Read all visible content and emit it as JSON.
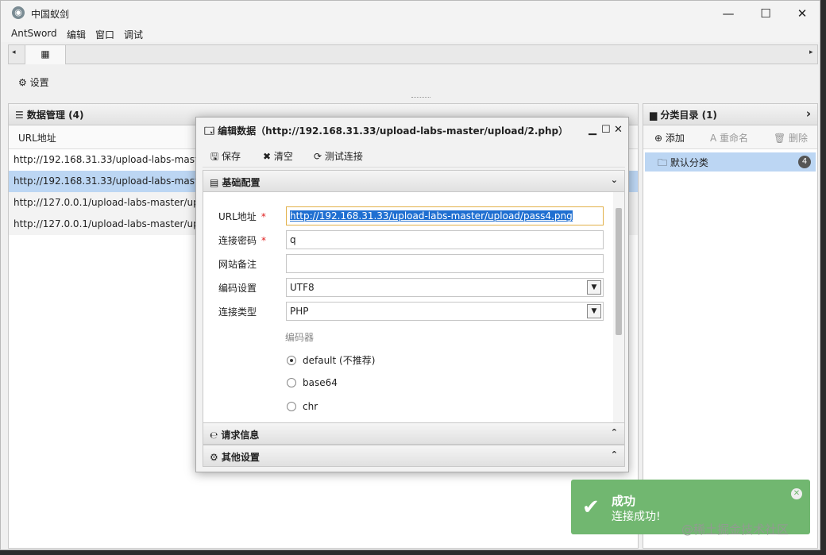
{
  "app": {
    "title": "中国蚁剑"
  },
  "window_controls": {
    "minimize": "—",
    "maximize": "☐",
    "close": "✕"
  },
  "menu": [
    "AntSword",
    "编辑",
    "窗口",
    "调试"
  ],
  "tabbar": {
    "left_arrow": "◂",
    "right_arrow": "▸",
    "home_tab_icon": "▦"
  },
  "toolbar": {
    "settings": "⚙ 设置"
  },
  "data_panel": {
    "title": "☰ 数据管理 (4)",
    "column_header": "URL地址",
    "rows": [
      "http://192.168.31.33/upload-labs-master",
      "http://192.168.31.33/upload-labs-master",
      "http://127.0.0.1/upload-labs-master/upl",
      "http://127.0.0.1/upload-labs-master/upl"
    ]
  },
  "category_panel": {
    "title": "▆ 分类目录 (1)",
    "chevron": "›",
    "add": "⊕ 添加",
    "rename": "A 重命名",
    "delete": "🗑 删除",
    "default_category": "🗀 默认分类",
    "count": "4"
  },
  "dialog": {
    "title": "🗔 编辑数据（http://192.168.31.33/upload-labs-master/upload/2.php）",
    "min": "▁",
    "max": "☐",
    "close": "✕",
    "save": "🖫 保存",
    "clear": "✖ 清空",
    "test": "⟳ 测试连接",
    "basic_section": "▤ 基础配置",
    "basic_chevron": "⌄",
    "fields": {
      "url_label": "URL地址",
      "url_value": "http://192.168.31.33/upload-labs-master/upload/pass4.png",
      "password_label": "连接密码",
      "password_value": "q",
      "note_label": "网站备注",
      "note_value": "",
      "encoding_label": "编码设置",
      "encoding_value": "UTF8",
      "type_label": "连接类型",
      "type_value": "PHP",
      "required_mark": "*",
      "encoder_label": "编码器"
    },
    "encoders": [
      "default (不推荐)",
      "base64",
      "chr"
    ],
    "selected_encoder": "default (不推荐)",
    "request_section": "℮ 请求信息",
    "other_section": "⚙ 其他设置",
    "section_chevron": "⌃"
  },
  "toast": {
    "title": "成功",
    "message": "连接成功!",
    "check": "✔",
    "close": "✕"
  },
  "watermark": "@稀土掘金技术社区"
}
